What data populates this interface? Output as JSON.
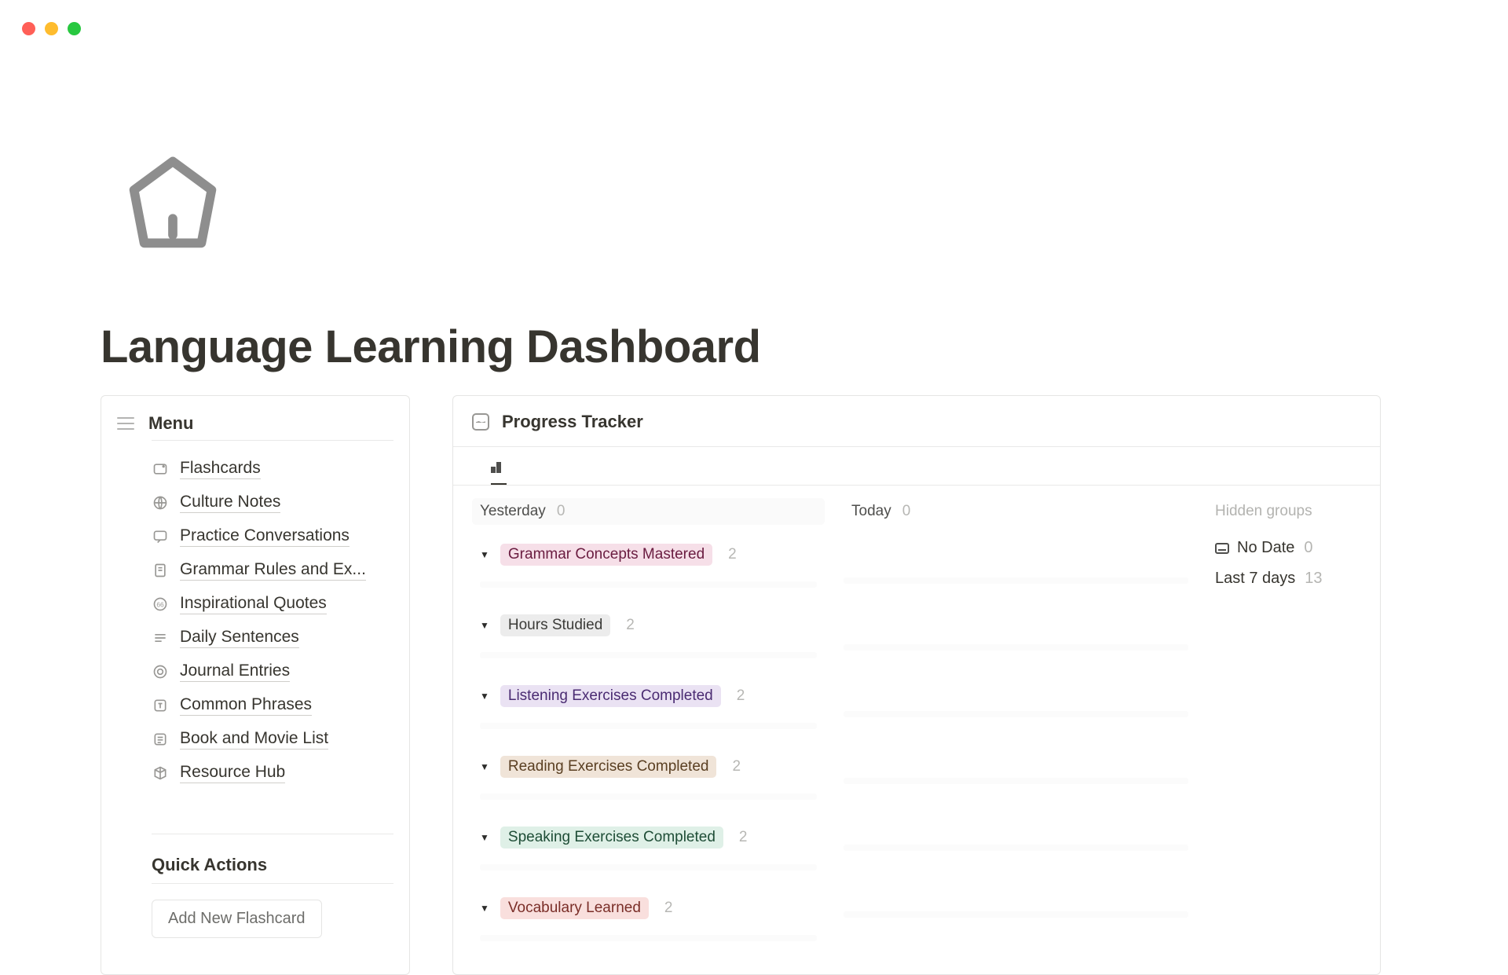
{
  "page": {
    "title": "Language Learning Dashboard"
  },
  "menu": {
    "title": "Menu",
    "items": [
      {
        "icon": "card-icon",
        "label": "Flashcards"
      },
      {
        "icon": "globe-icon",
        "label": "Culture Notes"
      },
      {
        "icon": "chat-icon",
        "label": "Practice Conversations"
      },
      {
        "icon": "doc-icon",
        "label": "Grammar Rules and Ex..."
      },
      {
        "icon": "quote-icon",
        "label": "Inspirational Quotes"
      },
      {
        "icon": "lines-icon",
        "label": "Daily Sentences"
      },
      {
        "icon": "journal-icon",
        "label": "Journal Entries"
      },
      {
        "icon": "text-icon",
        "label": "Common Phrases"
      },
      {
        "icon": "list-icon",
        "label": "Book and Movie List"
      },
      {
        "icon": "cube-icon",
        "label": "Resource Hub"
      }
    ],
    "quick_actions_title": "Quick Actions",
    "quick_actions": [
      {
        "label": "Add New Flashcard"
      }
    ]
  },
  "tracker": {
    "title": "Progress Tracker",
    "columns": {
      "yesterday": {
        "label": "Yesterday",
        "count": 0
      },
      "today": {
        "label": "Today",
        "count": 0
      }
    },
    "groups": [
      {
        "label": "Grammar Concepts Mastered",
        "pill_class": "pill-pink",
        "count": 2
      },
      {
        "label": "Hours Studied",
        "pill_class": "pill-gray",
        "count": 2
      },
      {
        "label": "Listening Exercises Completed",
        "pill_class": "pill-purple",
        "count": 2
      },
      {
        "label": "Reading Exercises Completed",
        "pill_class": "pill-tan",
        "count": 2
      },
      {
        "label": "Speaking Exercises Completed",
        "pill_class": "pill-green",
        "count": 2
      },
      {
        "label": "Vocabulary Learned",
        "pill_class": "pill-red",
        "count": 2
      }
    ],
    "hidden_groups_label": "Hidden groups",
    "side": {
      "no_date": {
        "label": "No Date",
        "count": 0
      },
      "last_7": {
        "label": "Last 7 days",
        "count": 13
      }
    }
  }
}
